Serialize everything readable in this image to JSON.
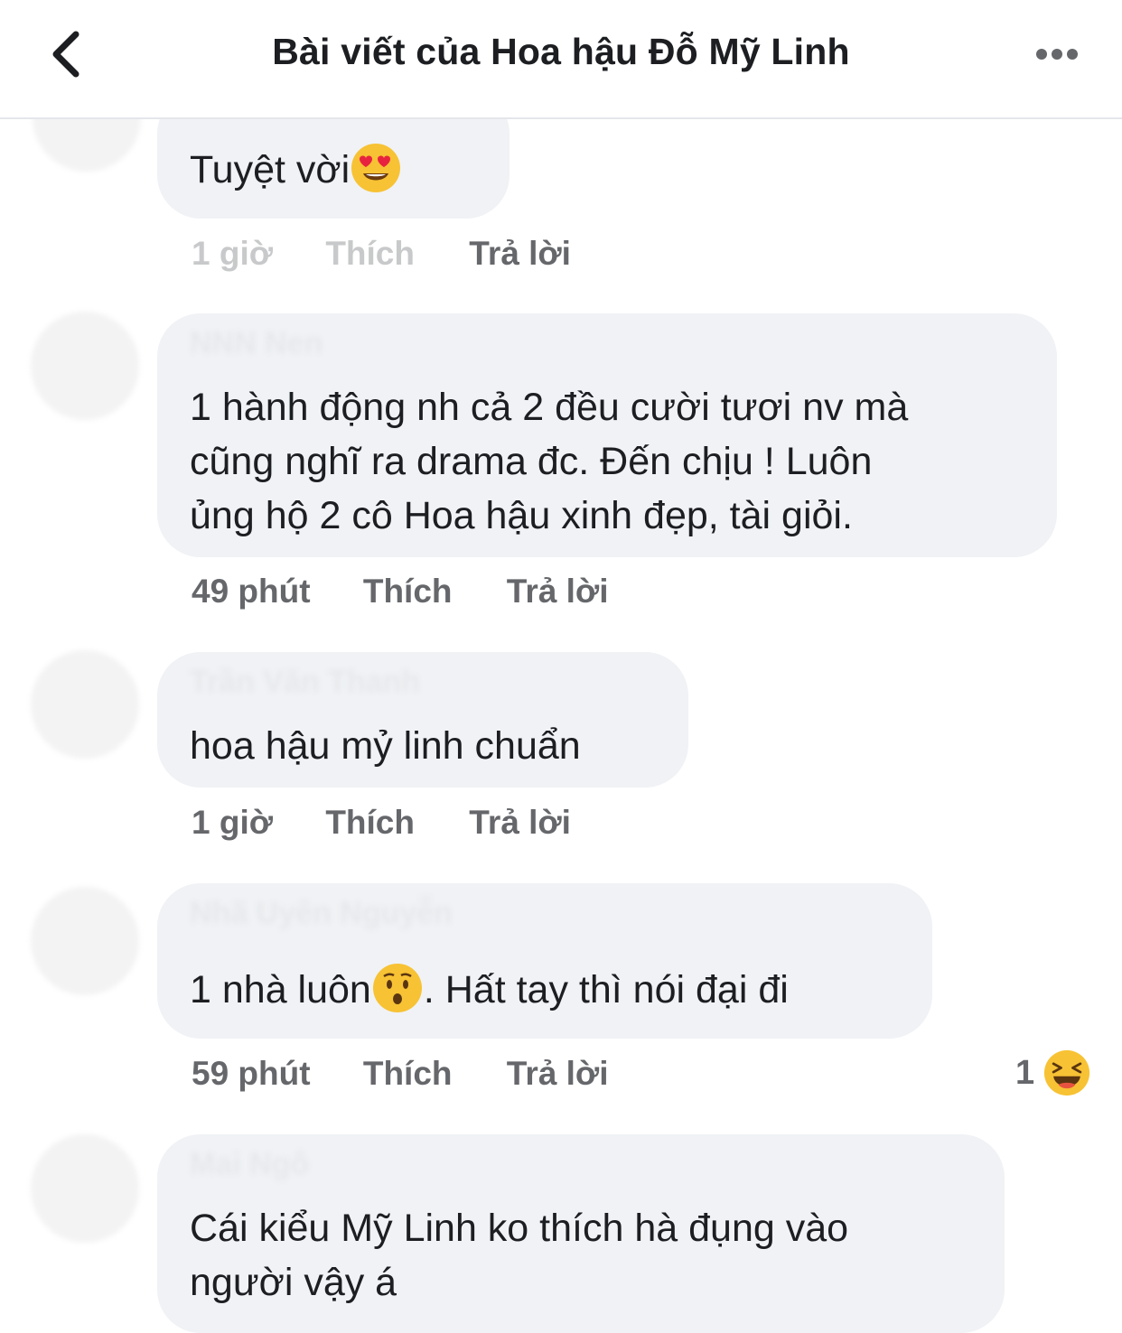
{
  "header": {
    "title": "Bài viết của Hoa hậu Đỗ Mỹ Linh"
  },
  "comments": [
    {
      "text": "Tuyệt vời",
      "emoji": "heart-eyes-emoji",
      "time": "1 giờ",
      "like_label": "Thích",
      "reply_label": "Trả lời"
    },
    {
      "text_lines": [
        "1 hành động nh cả 2 đều cười tươi nv mà",
        "cũng nghĩ ra drama đc. Đến chịu  ! Luôn",
        "ủng hộ 2 cô Hoa hậu xinh đẹp, tài giỏi."
      ],
      "time": "49 phút",
      "like_label": "Thích",
      "reply_label": "Trả lời"
    },
    {
      "text": "hoa hậu mỷ linh chuẩn",
      "time": "1 giờ",
      "like_label": "Thích",
      "reply_label": "Trả lời"
    },
    {
      "text_before": "1 nhà luôn",
      "emoji": "hushed-face-emoji",
      "text_after": ". Hất tay thì nói đại đi",
      "time": "59 phút",
      "like_label": "Thích",
      "reply_label": "Trả lời",
      "reaction_count": "1",
      "reaction_emoji": "laughing-emoji"
    },
    {
      "text_lines": [
        "Cái kiểu Mỹ Linh ko thích hà đụng vào",
        "người vậy á"
      ]
    }
  ]
}
